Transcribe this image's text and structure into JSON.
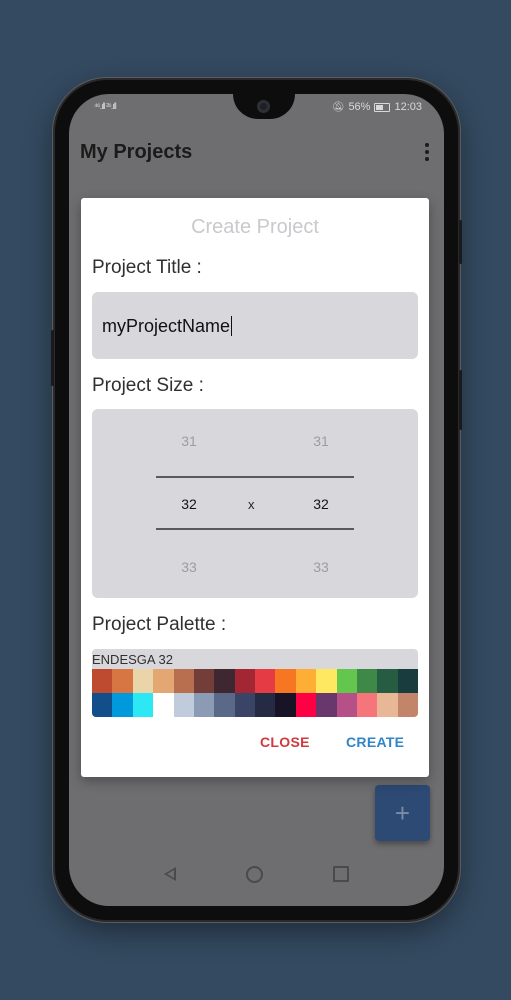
{
  "status": {
    "signal_left": "⁴⁶.ıll ²⁶.ıll",
    "battery_percent": "56%",
    "time": "12:03"
  },
  "appbar": {
    "title": "My Projects"
  },
  "fab": {
    "label": "+"
  },
  "dialog": {
    "title": "Create Project",
    "project_title_label": "Project Title :",
    "project_title_value": "myProjectName",
    "project_size_label": "Project Size :",
    "size_picker": {
      "width": {
        "prev": "31",
        "selected": "32",
        "next": "33"
      },
      "separator": "x",
      "height": {
        "prev": "31",
        "selected": "32",
        "next": "33"
      }
    },
    "project_palette_label": "Project Palette :",
    "palette": {
      "name": "ENDESGA 32",
      "colors_row1": [
        "#be4a2f",
        "#d77643",
        "#ead4aa",
        "#e4a672",
        "#b86f50",
        "#733e39",
        "#3e2731",
        "#a22633",
        "#e43b44",
        "#f77622",
        "#feae34",
        "#fee761",
        "#63c74d",
        "#3e8948",
        "#265c42",
        "#193c3e"
      ],
      "colors_row2": [
        "#124e89",
        "#0099db",
        "#2ce8f5",
        "#ffffff",
        "#c0cbdc",
        "#8b9bb4",
        "#5a6988",
        "#3a4466",
        "#262b44",
        "#181425",
        "#ff0044",
        "#68386c",
        "#b55088",
        "#f6757a",
        "#e8b796",
        "#c28569"
      ]
    },
    "close_label": "CLOSE",
    "create_label": "CREATE",
    "close_color": "#d0393e",
    "create_color": "#2f86c6"
  }
}
